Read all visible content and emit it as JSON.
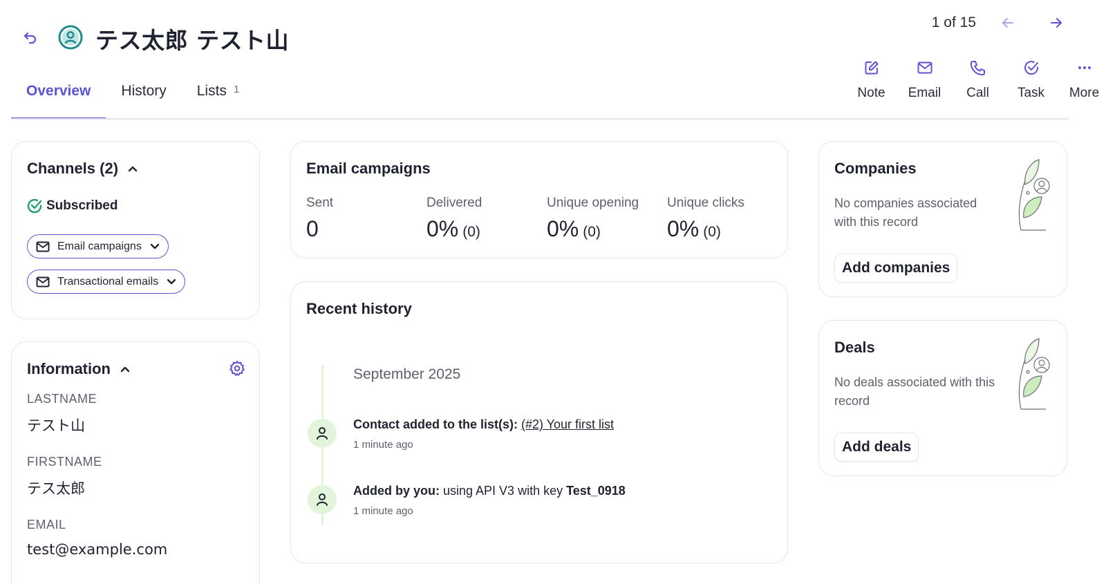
{
  "header": {
    "contact_name": "テス太郎 テスト山",
    "pager": {
      "label": "1 of 15"
    }
  },
  "tabs": [
    {
      "label": "Overview",
      "active": true
    },
    {
      "label": "History"
    },
    {
      "label": "Lists",
      "count": "1"
    }
  ],
  "actions": [
    {
      "label": "Note",
      "icon": "note-edit-icon"
    },
    {
      "label": "Email",
      "icon": "mail-icon"
    },
    {
      "label": "Call",
      "icon": "phone-icon"
    },
    {
      "label": "Task",
      "icon": "task-check-icon"
    },
    {
      "label": "More",
      "icon": "more-dots-icon"
    }
  ],
  "channels": {
    "title": "Channels (2)",
    "status": "Subscribed",
    "items": [
      {
        "label": "Email campaigns"
      },
      {
        "label": "Transactional emails"
      }
    ]
  },
  "information": {
    "title": "Information",
    "fields": [
      {
        "label": "LASTNAME",
        "value": "テスト山"
      },
      {
        "label": "FIRSTNAME",
        "value": "テス太郎"
      },
      {
        "label": "EMAIL",
        "value": "test@example.com"
      }
    ]
  },
  "email_campaigns": {
    "title": "Email campaigns",
    "stats": [
      {
        "label": "Sent",
        "value": "0",
        "sub": ""
      },
      {
        "label": "Delivered",
        "value": "0%",
        "sub": "(0)"
      },
      {
        "label": "Unique opening",
        "value": "0%",
        "sub": "(0)"
      },
      {
        "label": "Unique clicks",
        "value": "0%",
        "sub": "(0)"
      }
    ]
  },
  "recent_history": {
    "title": "Recent history",
    "month": "September 2025",
    "events": [
      {
        "prefix": "Contact added to the list(s): ",
        "link": "(#2) Your first list",
        "time": "1 minute ago"
      },
      {
        "prefix": "Added by you:",
        "middle": " using API V3 with key ",
        "key": "Test_0918",
        "time": "1 minute ago"
      }
    ]
  },
  "companies": {
    "title": "Companies",
    "description": "No companies associated with this record",
    "button": "Add companies"
  },
  "deals": {
    "title": "Deals",
    "description": "No deals associated with this record",
    "button": "Add deals"
  },
  "colors": {
    "accent": "#5b53d6",
    "success": "#1f9d6b",
    "timeline": "#e2f5db",
    "leaf": "#cdeebc"
  }
}
